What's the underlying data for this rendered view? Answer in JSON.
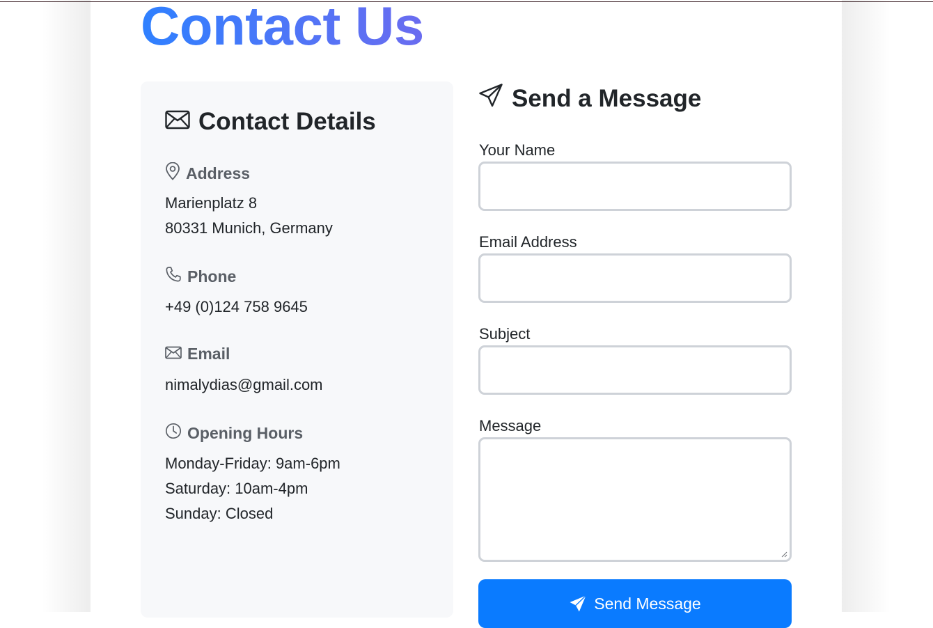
{
  "page": {
    "title": "Contact Us"
  },
  "details": {
    "heading": "Contact Details",
    "heading_icon": "envelope-icon",
    "address": {
      "label": "Address",
      "icon": "map-pin-icon",
      "lines": [
        "Marienplatz 8",
        "80331 Munich, Germany"
      ]
    },
    "phone": {
      "label": "Phone",
      "icon": "phone-icon",
      "value": "+49 (0)124 758 9645"
    },
    "email": {
      "label": "Email",
      "icon": "envelope-icon",
      "value": "nimalydias@gmail.com"
    },
    "hours": {
      "label": "Opening Hours",
      "icon": "clock-icon",
      "lines": [
        "Monday-Friday: 9am-6pm",
        "Saturday: 10am-4pm",
        "Sunday: Closed"
      ]
    }
  },
  "form": {
    "heading": "Send a Message",
    "heading_icon": "paper-plane-icon",
    "fields": [
      {
        "label": "Your Name",
        "value": ""
      },
      {
        "label": "Email Address",
        "value": ""
      },
      {
        "label": "Subject",
        "value": ""
      },
      {
        "label": "Message",
        "value": ""
      }
    ],
    "submit_label": "Send Message",
    "submit_icon": "paper-plane-filled-icon"
  },
  "colors": {
    "title_gradient_start": "#2f80ff",
    "title_gradient_end": "#6a6cf0",
    "button_bg": "#0a7bff",
    "panel_bg": "#f7f8fa",
    "input_border": "#ced2d8"
  }
}
